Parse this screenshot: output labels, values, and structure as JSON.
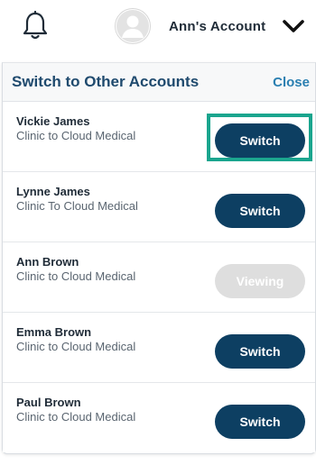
{
  "header": {
    "account_label": "Ann's Account",
    "bell_icon": "bell-icon",
    "avatar_icon": "user-avatar-icon",
    "chevron_icon": "chevron-down-icon"
  },
  "panel": {
    "title": "Switch to Other Accounts",
    "close_label": "Close"
  },
  "accounts": [
    {
      "name": "Vickie James",
      "org": "Clinic to Cloud Medical",
      "action": "Switch",
      "state": "switch"
    },
    {
      "name": "Lynne James",
      "org": "Clinic To Cloud Medical",
      "action": "Switch",
      "state": "switch"
    },
    {
      "name": "Ann Brown",
      "org": "Clinic to Cloud Medical",
      "action": "Viewing",
      "state": "viewing"
    },
    {
      "name": "Emma Brown",
      "org": "Clinic to Cloud Medical",
      "action": "Switch",
      "state": "switch"
    },
    {
      "name": "Paul Brown",
      "org": "Clinic to Cloud Medical",
      "action": "Switch",
      "state": "switch"
    }
  ],
  "colors": {
    "primary_button": "#0d3f62",
    "disabled_button": "#dedede",
    "highlight": "#1aa58e",
    "title_text": "#1f4a6e",
    "link_text": "#2a7fb1"
  }
}
